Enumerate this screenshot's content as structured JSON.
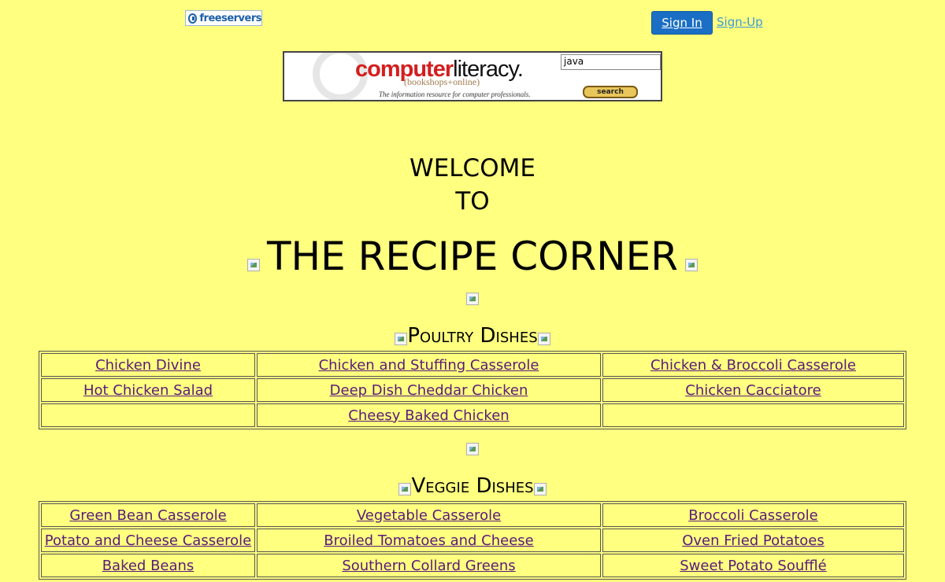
{
  "header": {
    "logo_text": "freeservers",
    "signin_label": "Sign In",
    "signup_label": "Sign-Up"
  },
  "ad": {
    "brand_red": "computer",
    "brand_black": "literacy.",
    "sub": "(bookshops+online)",
    "tagline": "The information resource for computer professionals.",
    "search_value": "java",
    "search_button": "search"
  },
  "welcome": {
    "line1": "WELCOME",
    "line2": "TO"
  },
  "title": "THE RECIPE CORNER",
  "sections": [
    {
      "heading": "Poultry Dishes",
      "rows": [
        [
          "Chicken Divine",
          "Chicken and Stuffing Casserole",
          "Chicken & Broccoli Casserole"
        ],
        [
          "Hot Chicken Salad",
          "Deep Dish Cheddar Chicken",
          "Chicken Cacciatore"
        ],
        [
          "",
          "Cheesy Baked Chicken",
          ""
        ]
      ]
    },
    {
      "heading": "Veggie Dishes",
      "rows": [
        [
          "Green Bean Casserole",
          "Vegetable Casserole",
          "Broccoli Casserole"
        ],
        [
          "Potato and Cheese Casserole",
          "Broiled Tomatoes and Cheese",
          "Oven Fried Potatoes"
        ],
        [
          "Baked Beans",
          "Southern Collard Greens",
          "Sweet Potato Soufflé"
        ]
      ]
    }
  ],
  "colors": {
    "background": "#ffff80",
    "link": "#5a1a7a",
    "signin_bg": "#1a6fc4",
    "signup_link": "#3d9ad8"
  }
}
